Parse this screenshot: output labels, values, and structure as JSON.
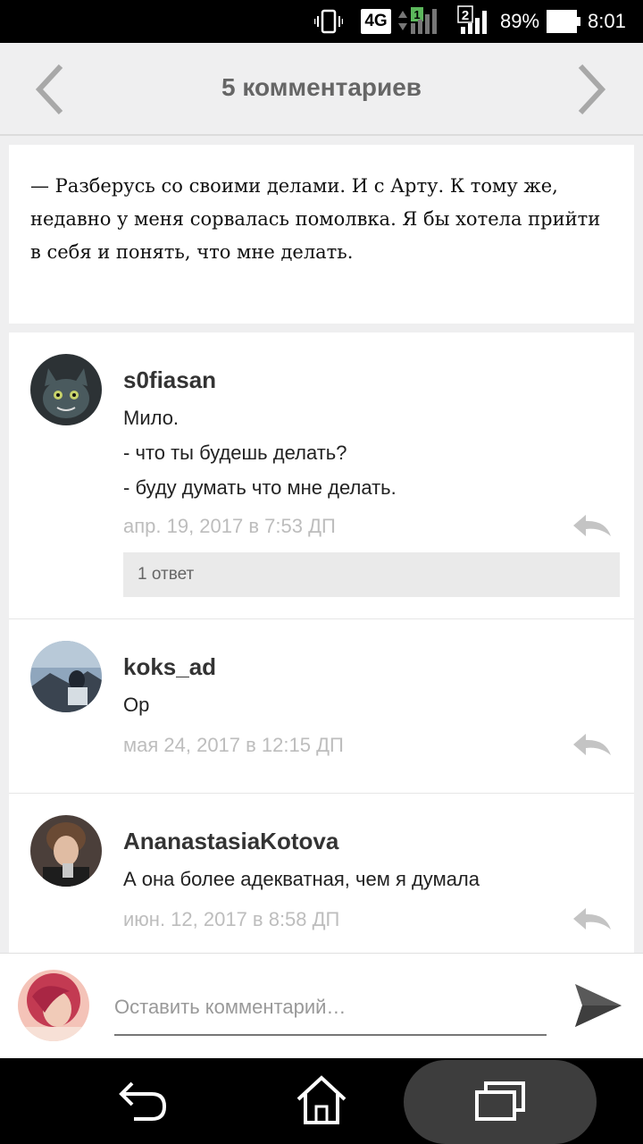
{
  "status_bar": {
    "network": "4G",
    "sim1_label": "1",
    "sim2_label": "2",
    "battery_percent": "89%",
    "time": "8:01"
  },
  "header": {
    "title": "5 комментариев",
    "prev_icon": "chevron-left-icon",
    "next_icon": "chevron-right-icon"
  },
  "quote": {
    "text": "— Разберусь со своими делами. И с Арту. К тому же, недавно у меня сорвалась помолвка. Я бы хотела прийти в себя и понять, что мне делать."
  },
  "comments": [
    {
      "author": "s0fiasan",
      "lines": [
        "Мило.",
        "- что ты будешь делать?",
        "- буду думать что мне делать."
      ],
      "timestamp": "апр. 19, 2017 в 7:53 ДП",
      "replies_label": "1 ответ"
    },
    {
      "author": "koks_ad",
      "lines": [
        "Ор"
      ],
      "timestamp": "мая 24, 2017 в 12:15 ДП"
    },
    {
      "author": "AnanastasiaKotova",
      "lines": [
        "А она более адекватная, чем я думала"
      ],
      "timestamp": "июн. 12, 2017 в 8:58 ДП"
    }
  ],
  "composer": {
    "placeholder": "Оставить комментарий…",
    "send_icon": "send-icon"
  },
  "navbar": {
    "back_icon": "back-icon",
    "home_icon": "home-icon",
    "recents_icon": "recents-icon"
  }
}
